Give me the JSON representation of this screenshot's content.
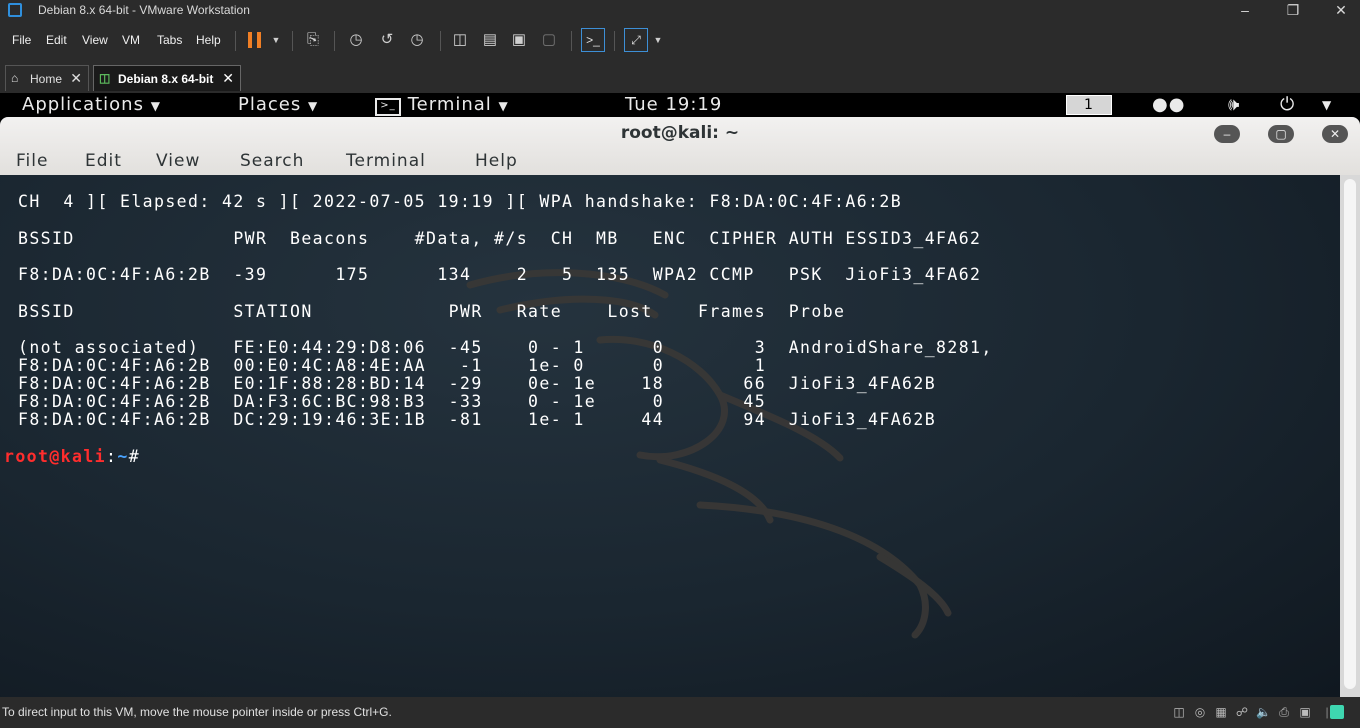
{
  "vmware": {
    "window_title": "Debian 8.x 64-bit - VMware Workstation",
    "menu": [
      "File",
      "Edit",
      "View",
      "VM",
      "Tabs",
      "Help"
    ],
    "tabs": [
      {
        "label": "Home",
        "icon": "home-icon"
      },
      {
        "label": "Debian 8.x 64-bit",
        "icon": "vm-icon"
      }
    ],
    "status_message": "To direct input to this VM, move the mouse pointer inside or press Ctrl+G.",
    "accent_color": "#f07f25"
  },
  "gnome": {
    "applications": "Applications",
    "places": "Places",
    "terminal": "Terminal",
    "clock": "Tue 19:19",
    "workspace": "1"
  },
  "terminal": {
    "title": "root@kali: ~",
    "menu": [
      "File",
      "Edit",
      "View",
      "Search",
      "Terminal",
      "Help"
    ],
    "lines": [
      "CH  4 ][ Elapsed: 42 s ][ 2022-07-05 19:19 ][ WPA handshake: F8:DA:0C:4F:A6:2B",
      "BSSID              PWR  Beacons    #Data, #/s  CH  MB   ENC  CIPHER AUTH ESSID3_4FA62",
      "F8:DA:0C:4F:A6:2B  -39      175      134    2   5  135  WPA2 CCMP   PSK  JioFi3_4FA62",
      "BSSID              STATION            PWR   Rate    Lost    Frames  Probe",
      "(not associated)   FE:E0:44:29:D8:06  -45    0 - 1      0        3  AndroidShare_8281,",
      "F8:DA:0C:4F:A6:2B  00:E0:4C:A8:4E:AA   -1    1e- 0      0        1",
      "F8:DA:0C:4F:A6:2B  E0:1F:88:28:BD:14  -29    0e- 1e    18       66  JioFi3_4FA62B",
      "F8:DA:0C:4F:A6:2B  DA:F3:6C:BC:98:B3  -33    0 - 1e     0       45",
      "F8:DA:0C:4F:A6:2B  DC:29:19:46:3E:1B  -81    1e- 1     44       94  JioFi3_4FA62B"
    ],
    "prompt_user": "root@kali",
    "prompt_sep": ":",
    "prompt_path": "~",
    "prompt_symbol": "#"
  }
}
